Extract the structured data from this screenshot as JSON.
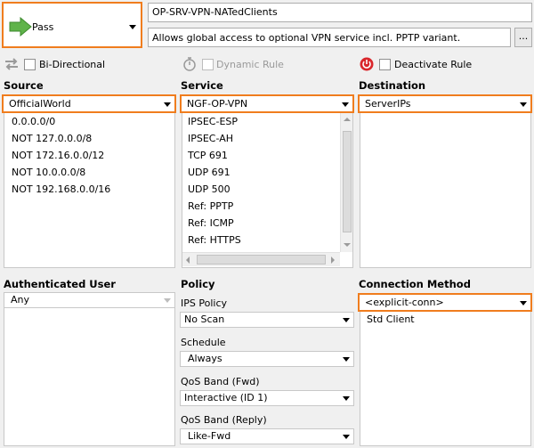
{
  "action": {
    "label": "Pass"
  },
  "rule": {
    "name": "OP-SRV-VPN-NATedClients",
    "description": "Allows global access to optional  VPN service incl. PPTP variant.",
    "more_label": "..."
  },
  "options": {
    "bidirectional": "Bi-Directional",
    "dynamic_rule": "Dynamic Rule",
    "deactivate_rule": "Deactivate Rule"
  },
  "source": {
    "heading": "Source",
    "selected": "OfficialWorld",
    "items": [
      "0.0.0.0/0",
      "NOT 127.0.0.0/8",
      "NOT 172.16.0.0/12",
      "NOT 10.0.0.0/8",
      "NOT 192.168.0.0/16"
    ]
  },
  "service": {
    "heading": "Service",
    "selected": "NGF-OP-VPN",
    "items": [
      "IPSEC-ESP",
      "IPSEC-AH",
      "TCP  691",
      "UDP  691",
      "UDP  500",
      "Ref: PPTP",
      "Ref: ICMP",
      "Ref: HTTPS"
    ]
  },
  "destination": {
    "heading": "Destination",
    "selected": "ServerIPs"
  },
  "auth_user": {
    "heading": "Authenticated User",
    "selected": "Any"
  },
  "policy": {
    "heading": "Policy",
    "ips_label": "IPS Policy",
    "ips_value": "No Scan",
    "schedule_label": "Schedule",
    "schedule_value": "Always",
    "qos_fwd_label": "QoS Band (Fwd)",
    "qos_fwd_value": "Interactive (ID 1)",
    "qos_reply_label": "QoS Band (Reply)",
    "qos_reply_value": "Like-Fwd"
  },
  "connection": {
    "heading": "Connection Method",
    "selected": "<explicit-conn>",
    "items": [
      "Std Client"
    ]
  },
  "colors": {
    "accent": "#f07d1e",
    "pass_green": "#5fb34a",
    "deactivate_red": "#d9262b"
  }
}
